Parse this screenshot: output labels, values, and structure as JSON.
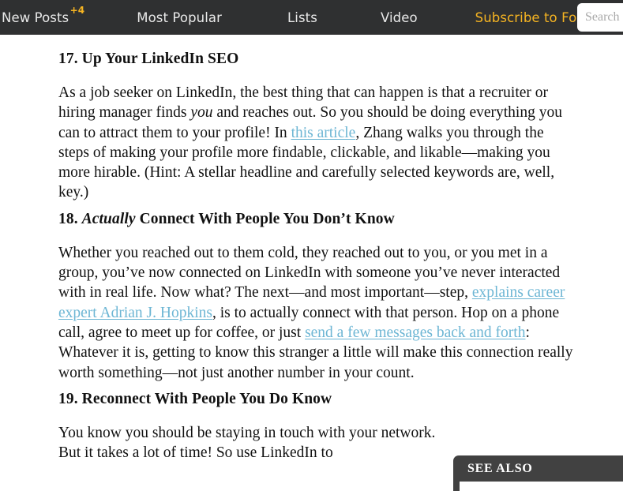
{
  "nav": {
    "items": [
      {
        "label": "New Posts",
        "badge": "+4"
      },
      {
        "label": "Most Popular"
      },
      {
        "label": "Lists"
      },
      {
        "label": "Video"
      },
      {
        "label": "Subscribe to Forbes"
      }
    ],
    "search": {
      "placeholder": "Search",
      "value": ""
    },
    "colors": {
      "background": "#2f3031",
      "accent": "#f6b422",
      "text": "#e9e9e9"
    }
  },
  "article": {
    "link_color": "#6db6d4",
    "sections": [
      {
        "heading_number": "17.",
        "heading_text": "Up Your LinkedIn SEO",
        "heading_full": "17. Up Your LinkedIn SEO",
        "paragraph_part_1": "As a job seeker on LinkedIn, the best thing that can happen is that a recruiter or hiring manager finds ",
        "paragraph_italic": "you",
        "paragraph_part_2": " and reaches out. So you should be doing everything you can to attract them to your profile! In ",
        "link_text": "this article",
        "paragraph_part_3": ", Zhang walks you through the steps of making your profile more findable, clickable, and likable—making you more hirable. (Hint: A stellar headline and carefully selected keywords are, well, key.)"
      },
      {
        "heading_number": "18.",
        "heading_italic": "Actually",
        "heading_rest": " Connect With People You Don’t Know",
        "heading_full": "18. Actually Connect With People You Don’t Know",
        "paragraph_part_1": "Whether you reached out to them cold, they reached out to you, or you met in a group, you’ve now connected on LinkedIn with someone you’ve never interacted with in real life. Now what? The next—and most important—step, ",
        "link_1_text": "explains career expert Adrian J. Hopkins",
        "paragraph_part_2": ", is to actually connect with that person. Hop on a phone call, agree to meet up for coffee, or just ",
        "link_2_text": "send a few messages back and forth",
        "paragraph_part_3": ": Whatever it is, getting to know this stranger a little will make this connection really worth something—not just another number in your count."
      },
      {
        "heading_number": "19.",
        "heading_text": "Reconnect With People You Do Know",
        "heading_full": "19. Reconnect With People You Do Know",
        "paragraph_part_1": "You know you should be staying in touch with your network. But it takes a lot of time! So use LinkedIn to"
      }
    ]
  },
  "see_also": {
    "title": "SEE ALSO",
    "header_color": "#414141"
  }
}
